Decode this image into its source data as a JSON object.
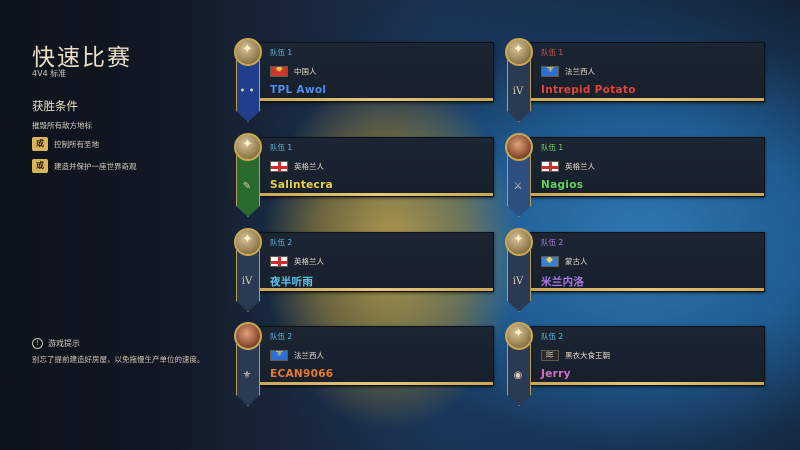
{
  "header": {
    "title": "快速比赛",
    "subtitle": "4V4 标准"
  },
  "victory": {
    "title": "获胜条件",
    "items": [
      {
        "prefix": "",
        "text": "摧毁所有敌方地标"
      },
      {
        "prefix": "或",
        "text": "控制所有圣地"
      },
      {
        "prefix": "或",
        "text": "建造并保护一座世界奇观"
      }
    ]
  },
  "tip": {
    "icon": "!",
    "title": "游戏提示",
    "text": "别忘了提前建造好房屋，以免拖慢生产单位的速度。"
  },
  "colors": {
    "team1": "#5ec2e8",
    "team2": "#5ec2e8",
    "team_label_red": "#e0524a",
    "team_label_green": "#7fd66a",
    "gold": "#c9a856"
  },
  "players": [
    {
      "team": "队伍 1",
      "team_color": "#5ec2e8",
      "civ": "中国人",
      "flag": "chinese",
      "name": "TPL Awol",
      "name_color": "#4f8ef0",
      "banner_color": "#1f3f8a",
      "banner_glyph": "• •",
      "medallion": "star"
    },
    {
      "team": "队伍 1",
      "team_color": "#e0524a",
      "civ": "法兰西人",
      "flag": "french",
      "name": "Intrepid Potato",
      "name_color": "#e0443b",
      "banner_color": "#2a3a52",
      "banner_glyph": "iV",
      "medallion": "star"
    },
    {
      "team": "队伍 1",
      "team_color": "#5ec2e8",
      "civ": "英格兰人",
      "flag": "english",
      "name": "Salintecra",
      "name_color": "#e8d34a",
      "banner_color": "#2b6a2f",
      "banner_glyph": "✎",
      "medallion": "star"
    },
    {
      "team": "队伍 1",
      "team_color": "#7fd66a",
      "civ": "英格兰人",
      "flag": "english",
      "name": "Nagios",
      "name_color": "#63d45b",
      "banner_color": "#2c4f80",
      "banner_glyph": "⚔",
      "medallion": "avatar"
    },
    {
      "team": "队伍 2",
      "team_color": "#5ec2e8",
      "civ": "英格兰人",
      "flag": "english",
      "name": "夜半听雨",
      "name_color": "#5ec2e8",
      "banner_color": "#2a3a52",
      "banner_glyph": "iV",
      "medallion": "star"
    },
    {
      "team": "队伍 2",
      "team_color": "#b080e8",
      "civ": "蒙古人",
      "flag": "mongol",
      "name": "米兰内洛",
      "name_color": "#a778e6",
      "banner_color": "#2a3a52",
      "banner_glyph": "iV",
      "medallion": "star"
    },
    {
      "team": "队伍 2",
      "team_color": "#5ec2e8",
      "civ": "法兰西人",
      "flag": "french",
      "name": "ECAN9066",
      "name_color": "#ea7a2c",
      "banner_color": "#2a3a52",
      "banner_glyph": "⚜",
      "medallion": "avatar"
    },
    {
      "team": "队伍 2",
      "team_color": "#5ec2e8",
      "civ": "黑衣大食王朝",
      "flag": "abbasid",
      "name": "Jerry",
      "name_color": "#d66fc8",
      "banner_color": "#2a3a52",
      "banner_glyph": "◉",
      "medallion": "star"
    }
  ]
}
